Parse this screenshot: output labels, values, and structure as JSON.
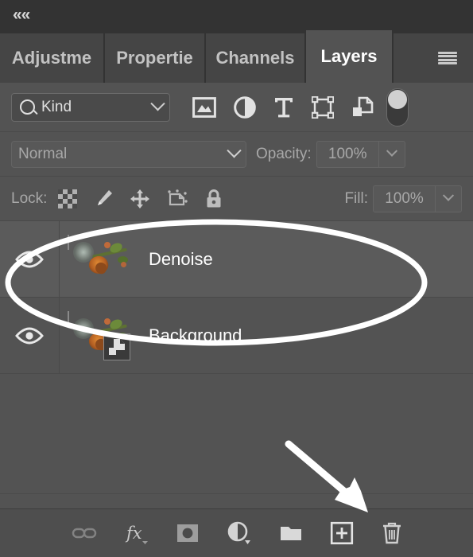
{
  "panel": {
    "collapse_label": "««",
    "menu_icon": "hamburger-menu-icon"
  },
  "tabs": [
    {
      "label": "Adjustme",
      "active": false
    },
    {
      "label": "Propertie",
      "active": false
    },
    {
      "label": "Channels",
      "active": false
    },
    {
      "label": "Layers",
      "active": true
    }
  ],
  "filter": {
    "kind_label": "Kind",
    "search_icon": "magnifier-icon",
    "icons": [
      "pixel-layer-filter-icon",
      "adjustment-layer-filter-icon",
      "type-layer-filter-icon",
      "shape-layer-filter-icon",
      "smart-object-filter-icon"
    ],
    "toggle_state": "on"
  },
  "blend": {
    "mode": "Normal",
    "opacity_label": "Opacity:",
    "opacity_value": "100%"
  },
  "lock": {
    "label": "Lock:",
    "icons": [
      "lock-transparent-pixels-icon",
      "lock-image-pixels-icon",
      "lock-position-icon",
      "lock-artboard-nesting-icon",
      "lock-all-icon"
    ],
    "fill_label": "Fill:",
    "fill_value": "100%"
  },
  "layers": [
    {
      "name": "Denoise",
      "visible": true,
      "selected": true,
      "smart_object": false,
      "visibility_icon": "eye-icon"
    },
    {
      "name": "Background",
      "visible": true,
      "selected": false,
      "smart_object": true,
      "visibility_icon": "eye-icon"
    }
  ],
  "bottom_toolbar": [
    {
      "name": "link-layers-button",
      "icon": "link-icon",
      "disabled": true
    },
    {
      "name": "layer-style-button",
      "icon": "fx-icon",
      "disabled": false
    },
    {
      "name": "add-layer-mask-button",
      "icon": "mask-icon",
      "disabled": false
    },
    {
      "name": "new-adjustment-layer-button",
      "icon": "half-circle-icon",
      "disabled": false
    },
    {
      "name": "new-group-button",
      "icon": "folder-icon",
      "disabled": false
    },
    {
      "name": "new-layer-button",
      "icon": "plus-square-icon",
      "disabled": false
    },
    {
      "name": "delete-layer-button",
      "icon": "trash-icon",
      "disabled": false
    }
  ],
  "annotations": {
    "highlight_color": "#ffffff",
    "ellipse": "ellipse-highlight-denoise-layer",
    "arrow": "arrow-pointing-to-new-layer-button"
  }
}
